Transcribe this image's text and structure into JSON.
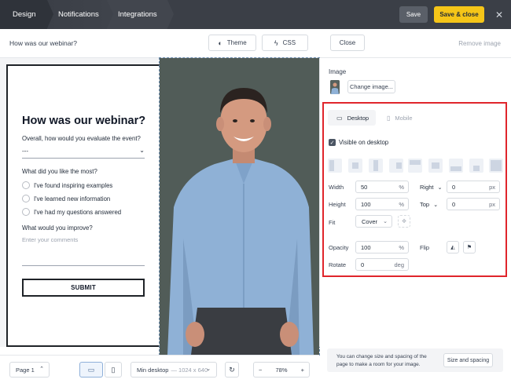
{
  "topbar": {
    "tabs": [
      "Design",
      "Notifications",
      "Integrations"
    ],
    "save_label": "Save",
    "save_close_label": "Save & close",
    "close_glyph": "✕"
  },
  "subbar": {
    "form_title": "How was our webinar?",
    "theme_label": "Theme",
    "css_label": "CSS",
    "close_label": "Close",
    "remove_image_label": "Remove image"
  },
  "form": {
    "heading": "How was our webinar?",
    "q1": "Overall, how would you evaluate the event?",
    "q1_value": "---",
    "q2": "What did you like the most?",
    "options": [
      "I've found inspiring examples",
      "I've learned new information",
      "I've had my questions answered"
    ],
    "q3": "What would you improve?",
    "q3_placeholder": "Enter your comments",
    "submit_label": "SUBMIT"
  },
  "panel": {
    "image_label": "Image",
    "change_image_label": "Change image...",
    "device_tabs": [
      "Desktop",
      "Mobile"
    ],
    "visible_label": "Visible on desktop",
    "visible_checked": true,
    "width_label": "Width",
    "width_value": "50",
    "width_unit": "%",
    "right_label": "Right",
    "right_value": "0",
    "right_unit": "px",
    "height_label": "Height",
    "height_value": "100",
    "height_unit": "%",
    "top_label": "Top",
    "top_value": "0",
    "top_unit": "px",
    "fit_label": "Fit",
    "fit_value": "Cover",
    "opacity_label": "Opacity",
    "opacity_value": "100",
    "opacity_unit": "%",
    "flip_label": "Flip",
    "rotate_label": "Rotate",
    "rotate_value": "0",
    "rotate_unit": "deg",
    "hint_text": "You can change size and spacing of the page to make a room for your image.",
    "size_spacing_label": "Size and spacing"
  },
  "bottombar": {
    "page_label": "Page 1",
    "min_desktop_label": "Min desktop",
    "min_desktop_size": "— 1024 x 640",
    "zoom_minus": "−",
    "zoom_value": "78%",
    "zoom_plus": "+"
  },
  "colors": {
    "accent_yellow": "#f5c518",
    "highlight_red": "#e0252b",
    "topbar": "#3b3f47"
  }
}
